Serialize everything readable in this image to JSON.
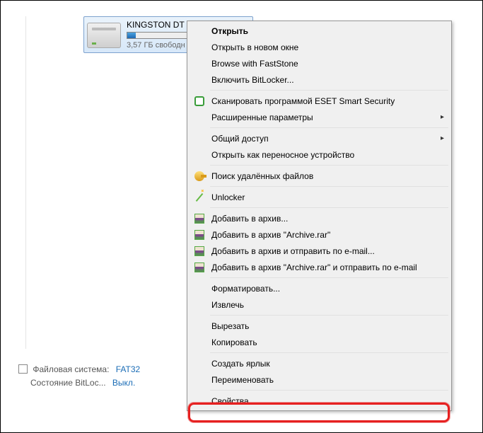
{
  "drive": {
    "name": "KINGSTON DT (",
    "free": "3,57 ГБ свободн"
  },
  "footer": {
    "fs_label": "Файловая система:",
    "fs_value": "FAT32",
    "bl_label": "Состояние BitLoc...",
    "bl_value": "Выкл."
  },
  "context": {
    "open": "Открыть",
    "open_new": "Открыть в новом окне",
    "browse_fs": "Browse with FastStone",
    "bitlocker": "Включить BitLocker...",
    "eset_scan": "Сканировать программой ESET Smart Security",
    "eset_adv": "Расширенные параметры",
    "share": "Общий доступ",
    "portable": "Открыть как переносное устройство",
    "search_del": "Поиск удалённых файлов",
    "unlocker": "Unlocker",
    "rar_add": "Добавить в архив...",
    "rar_add_named": "Добавить в архив \"Archive.rar\"",
    "rar_email": "Добавить в архив и отправить по e-mail...",
    "rar_email_named": "Добавить в архив \"Archive.rar\" и отправить по e-mail",
    "format": "Форматировать...",
    "eject": "Извлечь",
    "cut": "Вырезать",
    "copy": "Копировать",
    "shortcut": "Создать ярлык",
    "rename": "Переименовать",
    "properties": "Свойства"
  }
}
